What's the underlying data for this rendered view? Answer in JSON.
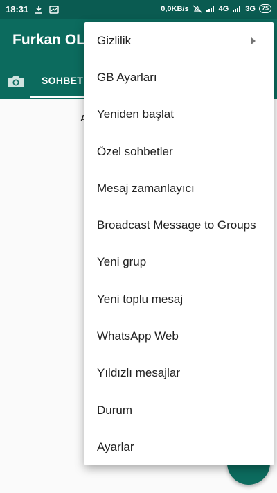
{
  "status_bar": {
    "time": "18:31",
    "network_speed": "0,0KB/s",
    "signal_4g": "4G",
    "signal_3g": "3G",
    "battery": "75",
    "icons": [
      "download-icon",
      "image-icon",
      "mute-icon",
      "signal-icon",
      "battery-icon"
    ]
  },
  "app_bar": {
    "title": "Furkan OL",
    "tab_label": "SOHBETL",
    "camera_icon": "camera-icon"
  },
  "content": {
    "fragment": "A"
  },
  "menu": {
    "items": [
      {
        "label": "Gizlilik",
        "has_submenu": true
      },
      {
        "label": "GB Ayarları"
      },
      {
        "label": "Yeniden başlat"
      },
      {
        "label": "Özel sohbetler"
      },
      {
        "label": "Mesaj zamanlayıcı"
      },
      {
        "label": "Broadcast Message to Groups"
      },
      {
        "label": "Yeni grup"
      },
      {
        "label": "Yeni toplu mesaj"
      },
      {
        "label": "WhatsApp Web"
      },
      {
        "label": "Yıldızlı mesajlar"
      },
      {
        "label": "Durum"
      },
      {
        "label": "Ayarlar"
      }
    ]
  },
  "colors": {
    "status_bar": "#0a5b51",
    "app_bar": "#0c6b5e",
    "fab": "#0c6b5e",
    "menu_text": "#212121"
  }
}
